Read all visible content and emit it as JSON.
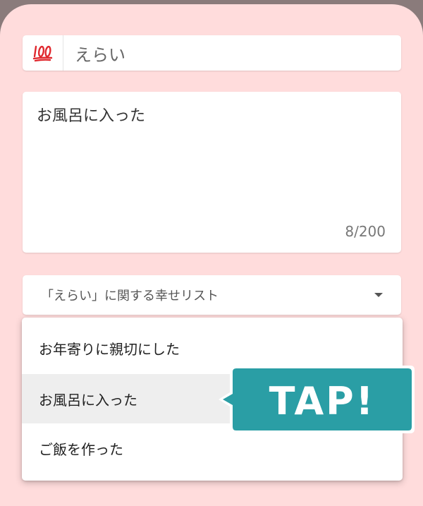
{
  "tag": {
    "icon": "hundred-points-emoji",
    "label": "えらい"
  },
  "entry": {
    "text": "お風呂に入った",
    "counter": "8/200"
  },
  "suggestions": {
    "select_label": "「えらい」に関する幸せリスト",
    "items": [
      {
        "label": "お年寄りに親切にした"
      },
      {
        "label": "お風呂に入った"
      },
      {
        "label": "ご飯を作った"
      }
    ],
    "selected_index": 1
  },
  "callout": {
    "text": "TAP!",
    "color": "#2a9ea5"
  },
  "colors": {
    "sheet_background": "#ffdcdc",
    "card_background": "#ffffff",
    "selected_row": "#eeeeee"
  }
}
